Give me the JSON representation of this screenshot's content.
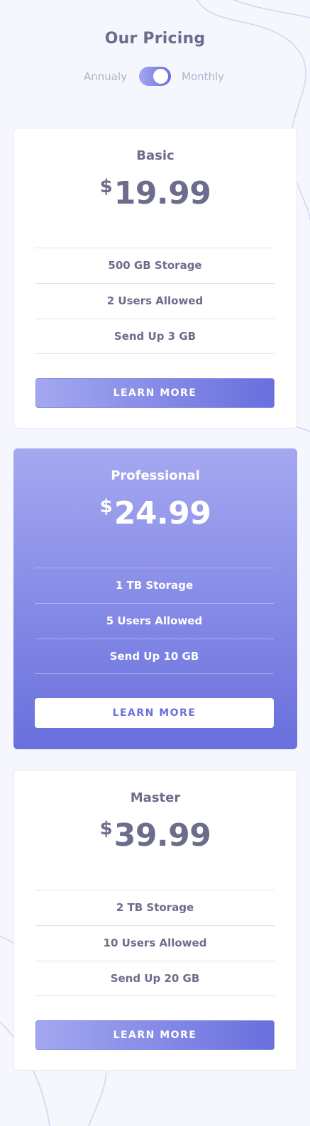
{
  "header": {
    "title": "Our Pricing",
    "toggle": {
      "left_label": "Annualy",
      "right_label": "Monthly",
      "selected": "Monthly"
    }
  },
  "plans": [
    {
      "name": "Basic",
      "currency": "$",
      "price": "19.99",
      "features": [
        "500 GB Storage",
        "2 Users Allowed",
        "Send Up 3 GB"
      ],
      "button": "LEARN MORE",
      "featured": false
    },
    {
      "name": "Professional",
      "currency": "$",
      "price": "24.99",
      "features": [
        "1 TB Storage",
        "5 Users Allowed",
        "Send Up 10 GB"
      ],
      "button": "LEARN MORE",
      "featured": true
    },
    {
      "name": "Master",
      "currency": "$",
      "price": "39.99",
      "features": [
        "2 TB Storage",
        "10 Users Allowed",
        "Send Up 20 GB"
      ],
      "button": "LEARN MORE",
      "featured": false
    }
  ],
  "colors": {
    "background": "#f6f6fe",
    "text": "#6b6d8a",
    "accent_light": "#a5a8f0",
    "accent_dark": "#696fdd",
    "muted": "#b0b2c8"
  }
}
